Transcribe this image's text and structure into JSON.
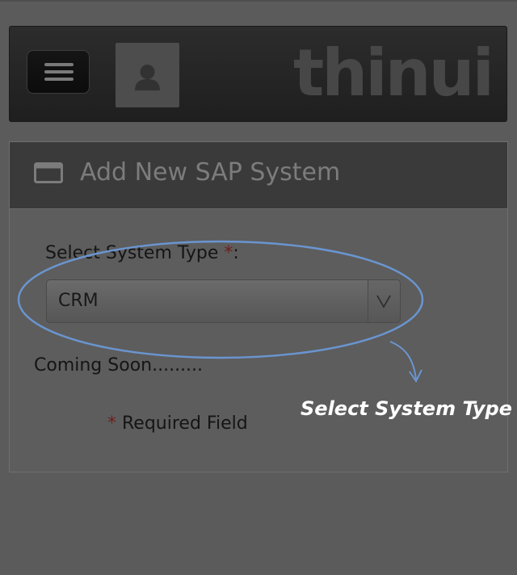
{
  "header": {
    "menu_icon": "hamburger-menu-icon",
    "avatar_icon": "user-icon",
    "logo_text": "thinui"
  },
  "panel": {
    "title_icon": "window-icon",
    "title": "Add New SAP System"
  },
  "form": {
    "system_type_label": "Select System Type ",
    "required_star": "*",
    "label_colon": ":",
    "system_type_value": "CRM",
    "dropdown_icon": "chevron-down-icon",
    "coming_soon": "Coming Soon.........",
    "required_note_star": "*",
    "required_note_text": " Required Field"
  },
  "annotation": {
    "text": "Select System Type",
    "color": "#6a95d0"
  },
  "colors": {
    "background": "#5b5b5b",
    "header_bg": "#222222",
    "panel_header_bg": "#3a3a3a",
    "required_star": "#6e1f1f"
  }
}
